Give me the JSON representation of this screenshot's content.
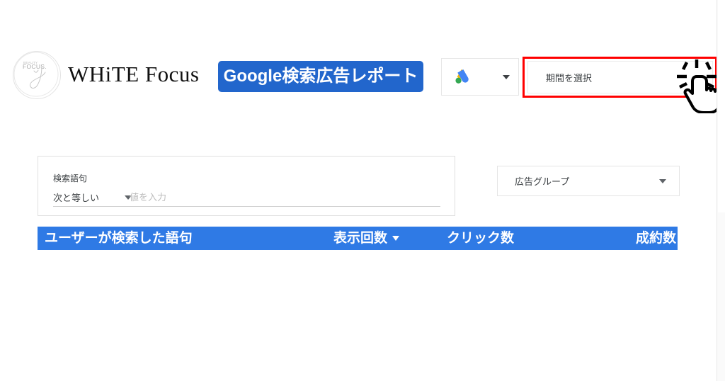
{
  "brand": {
    "logo_icon": "beauty-focus-circle-logo",
    "logo_text_top": "BEAUTY",
    "logo_text_main": "FOCUS.",
    "title": "WHiTE Focus"
  },
  "header": {
    "report_label": "Google検索広告レポート",
    "report_bg_color": "#2266cc",
    "account_selector": {
      "icon": "google-ads-icon",
      "caret_icon": "chevron-down-icon"
    },
    "period_selector": {
      "label": "期間を選択",
      "highlight_color": "#ff0000",
      "cursor_icon": "click-hand-cursor-icon"
    }
  },
  "filters": {
    "search_term": {
      "label": "検索語句",
      "operator_value": "次と等しい",
      "operator_caret_icon": "chevron-down-icon",
      "value": "",
      "placeholder": "値を入力"
    },
    "ad_group": {
      "label": "広告グループ",
      "caret_icon": "chevron-down-icon"
    }
  },
  "table": {
    "header_bg_color": "#2f7ae5",
    "columns": [
      {
        "label": "ユーザーが検索した語句",
        "sorted": false
      },
      {
        "label": "表示回数",
        "sorted": true,
        "sort_icon": "sort-descending-icon"
      },
      {
        "label": "クリック数",
        "sorted": false
      },
      {
        "label": "成約数",
        "sorted": false
      }
    ],
    "rows": []
  }
}
